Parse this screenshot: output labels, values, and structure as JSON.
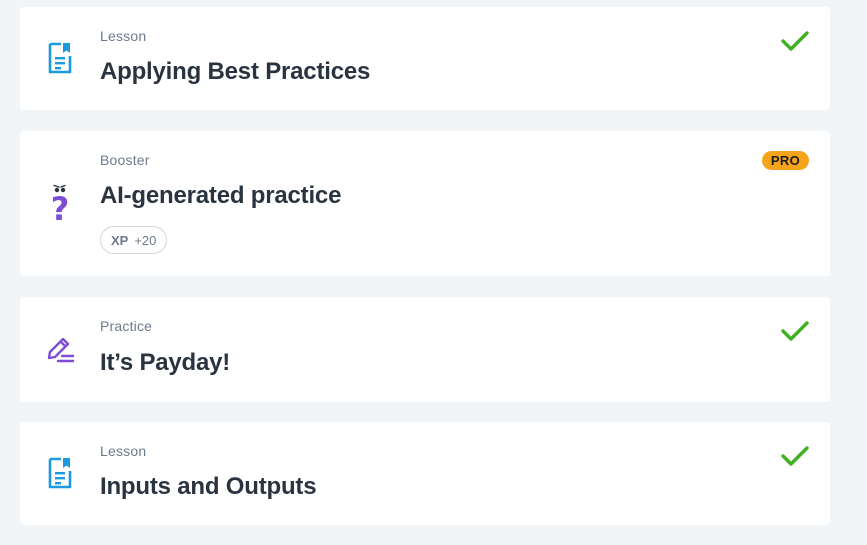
{
  "items": [
    {
      "kind": "Lesson",
      "title": "Applying Best Practices",
      "icon": "lesson-document-icon",
      "status": "completed"
    },
    {
      "kind": "Booster",
      "title": "AI-generated practice",
      "icon": "question-mark-icon",
      "badge": "PRO",
      "xp_label": "XP",
      "xp_value": "+20"
    },
    {
      "kind": "Practice",
      "title": "It’s Payday!",
      "icon": "pencil-edit-icon",
      "status": "completed"
    },
    {
      "kind": "Lesson",
      "title": "Inputs and Outputs",
      "icon": "lesson-document-icon",
      "status": "completed"
    }
  ],
  "colors": {
    "lesson_icon": "#1b9ae0",
    "purple_icon": "#7d4dd6",
    "check": "#3fb01f",
    "pro_badge": "#f5a31a"
  }
}
